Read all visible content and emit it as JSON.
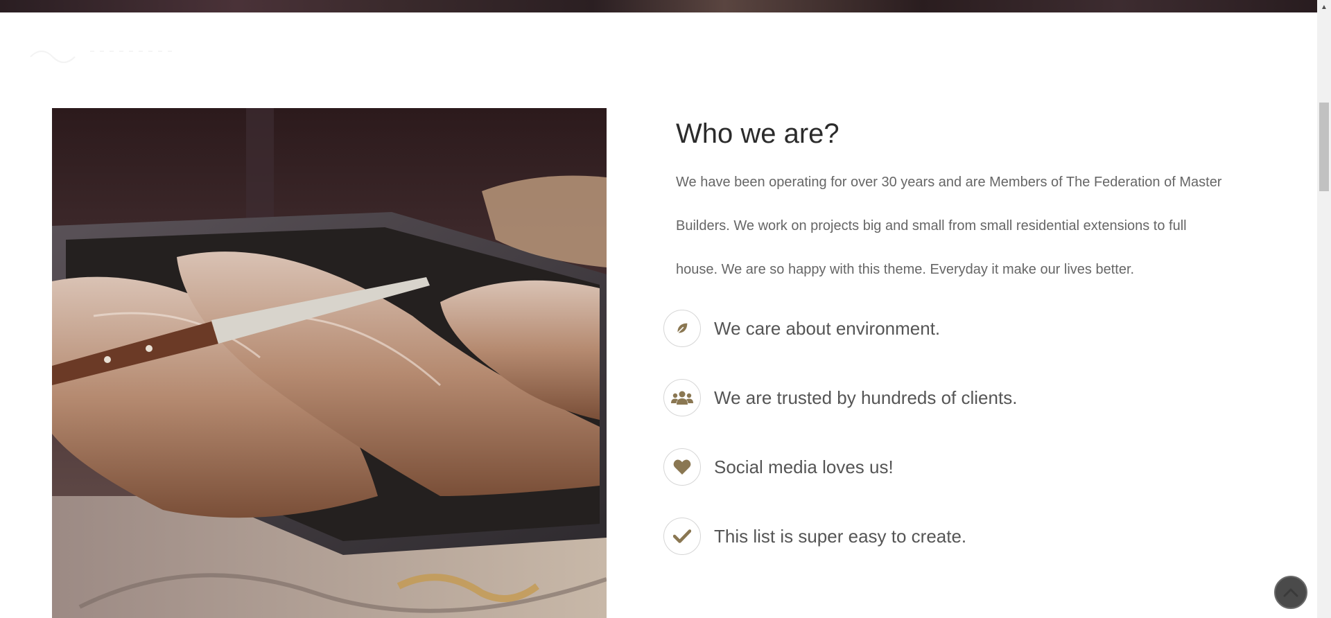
{
  "about": {
    "heading": "Who we are?",
    "paragraph": "We have been operating for over 30 years and are Members of The Federation of Master Builders. We work on projects big and small from small residential extensions to full house. We are so happy with this theme. Everyday it make our lives better.",
    "features": [
      {
        "icon": "leaf-icon",
        "text": "We care about environment."
      },
      {
        "icon": "users-icon",
        "text": "We are trusted by hundreds of clients."
      },
      {
        "icon": "heart-icon",
        "text": "Social media loves us!"
      },
      {
        "icon": "check-icon",
        "text": "This list is super easy to create."
      }
    ]
  },
  "colors": {
    "accent": "#8a7752",
    "heading": "#2b2b2b",
    "body_text": "#666666",
    "feature_text": "#555555",
    "back_to_top": "#4a4a4a"
  },
  "controls": {
    "back_to_top_icon": "chevron-up-icon",
    "scroll_up_icon": "triangle-up-icon"
  }
}
